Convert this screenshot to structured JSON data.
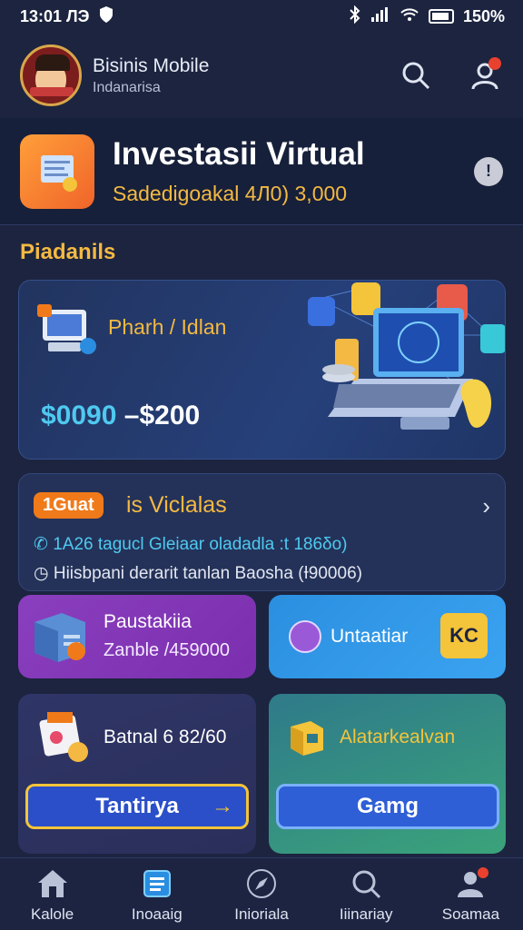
{
  "status": {
    "time": "13:01 ЛЭ",
    "battery": "150%"
  },
  "header": {
    "title": "Bisinis Mobile",
    "subtitle": "Indanarisa"
  },
  "hero": {
    "title": "Investasii Virtual",
    "subtitle": "Sadedigoakal 4Л0) 3,000",
    "info": "!"
  },
  "section": {
    "label": "Piadanils"
  },
  "promo": {
    "title": "Pharh / Idlan",
    "range_a": "$0090",
    "range_b": "–$200"
  },
  "list": {
    "pill": "1Guat",
    "title": "is Viclalas",
    "row1": "1A26 tagucl Gleiaar oladadla :t 186δo)",
    "row2": "Hiisbpani derarit tanlan Baosha (Ɨ90006)"
  },
  "tiles": {
    "purple": {
      "title": "Paustakiia",
      "sub": "Zanble /459000"
    },
    "blue": {
      "title": "Untaatiar",
      "badge": "KC"
    },
    "dark": {
      "title": "Batnal 6 82/60",
      "button": "Tantirya"
    },
    "green": {
      "title": "Alatarkealvan",
      "button": "Gamg"
    }
  },
  "nav": [
    {
      "label": "Kalole"
    },
    {
      "label": "Inoaaig"
    },
    {
      "label": "Inioriala"
    },
    {
      "label": "Iiinariay"
    },
    {
      "label": "Soamaa"
    }
  ],
  "colors": {
    "accent": "#f4b942",
    "cyan": "#4fc9f0",
    "bg": "#1c2440"
  }
}
